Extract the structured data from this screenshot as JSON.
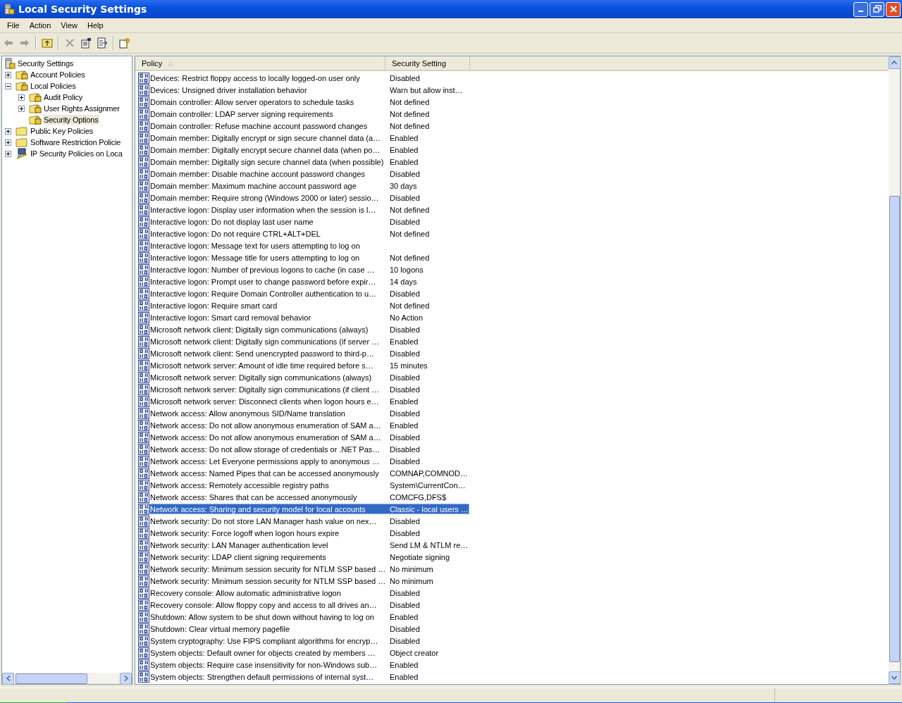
{
  "window": {
    "title": "Local Security Settings"
  },
  "menu": [
    "File",
    "Action",
    "View",
    "Help"
  ],
  "tree": [
    {
      "label": "Security Settings",
      "kind": "root",
      "selected": false,
      "children": [
        {
          "label": "Account Policies",
          "kind": "locked-folder",
          "selected": false,
          "expanded": false
        },
        {
          "label": "Local Policies",
          "kind": "locked-folder",
          "selected": false,
          "expanded": true,
          "children": [
            {
              "label": "Audit Policy",
              "kind": "locked-folder",
              "selected": false,
              "expanded": false
            },
            {
              "label": "User Rights Assignmer",
              "kind": "locked-folder",
              "selected": false,
              "expanded": false
            },
            {
              "label": "Security Options",
              "kind": "locked-folder",
              "selected": true
            }
          ]
        },
        {
          "label": "Public Key Policies",
          "kind": "folder",
          "selected": false,
          "expanded": false
        },
        {
          "label": "Software Restriction Policie",
          "kind": "folder",
          "selected": false,
          "expanded": false
        },
        {
          "label": "IP Security Policies on Loca",
          "kind": "network",
          "selected": false,
          "expanded": false
        }
      ]
    }
  ],
  "table": {
    "columns": [
      "Policy",
      "Security Setting"
    ],
    "rows": [
      {
        "policy": "Devices: Restrict floppy access to locally logged-on user only",
        "setting": "Disabled",
        "selected": false
      },
      {
        "policy": "Devices: Unsigned driver installation behavior",
        "setting": "Warn but allow inst…",
        "selected": false
      },
      {
        "policy": "Domain controller: Allow server operators to schedule tasks",
        "setting": "Not defined",
        "selected": false
      },
      {
        "policy": "Domain controller: LDAP server signing requirements",
        "setting": "Not defined",
        "selected": false
      },
      {
        "policy": "Domain controller: Refuse machine account password changes",
        "setting": "Not defined",
        "selected": false
      },
      {
        "policy": "Domain member: Digitally encrypt or sign secure channel data (a…",
        "setting": "Enabled",
        "selected": false
      },
      {
        "policy": "Domain member: Digitally encrypt secure channel data (when po…",
        "setting": "Enabled",
        "selected": false
      },
      {
        "policy": "Domain member: Digitally sign secure channel data (when possible)",
        "setting": "Enabled",
        "selected": false
      },
      {
        "policy": "Domain member: Disable machine account password changes",
        "setting": "Disabled",
        "selected": false
      },
      {
        "policy": "Domain member: Maximum machine account password age",
        "setting": "30 days",
        "selected": false
      },
      {
        "policy": "Domain member: Require strong (Windows 2000 or later) sessio…",
        "setting": "Disabled",
        "selected": false
      },
      {
        "policy": "Interactive logon: Display user information when the session is l…",
        "setting": "Not defined",
        "selected": false
      },
      {
        "policy": "Interactive logon: Do not display last user name",
        "setting": "Disabled",
        "selected": false
      },
      {
        "policy": "Interactive logon: Do not require CTRL+ALT+DEL",
        "setting": "Not defined",
        "selected": false
      },
      {
        "policy": "Interactive logon: Message text for users attempting to log on",
        "selected": false
      },
      {
        "policy": "Interactive logon: Message title for users attempting to log on",
        "setting": "Not defined",
        "selected": false
      },
      {
        "policy": "Interactive logon: Number of previous logons to cache (in case …",
        "setting": "10 logons",
        "selected": false
      },
      {
        "policy": "Interactive logon: Prompt user to change password before expir…",
        "setting": "14 days",
        "selected": false
      },
      {
        "policy": "Interactive logon: Require Domain Controller authentication to u…",
        "setting": "Disabled",
        "selected": false
      },
      {
        "policy": "Interactive logon: Require smart card",
        "setting": "Not defined",
        "selected": false
      },
      {
        "policy": "Interactive logon: Smart card removal behavior",
        "setting": "No Action",
        "selected": false
      },
      {
        "policy": "Microsoft network client: Digitally sign communications (always)",
        "setting": "Disabled",
        "selected": false
      },
      {
        "policy": "Microsoft network client: Digitally sign communications (if server …",
        "setting": "Enabled",
        "selected": false
      },
      {
        "policy": "Microsoft network client: Send unencrypted password to third-p…",
        "setting": "Disabled",
        "selected": false
      },
      {
        "policy": "Microsoft network server: Amount of idle time required before s…",
        "setting": "15 minutes",
        "selected": false
      },
      {
        "policy": "Microsoft network server: Digitally sign communications (always)",
        "setting": "Disabled",
        "selected": false
      },
      {
        "policy": "Microsoft network server: Digitally sign communications (if client …",
        "setting": "Disabled",
        "selected": false
      },
      {
        "policy": "Microsoft network server: Disconnect clients when logon hours e…",
        "setting": "Enabled",
        "selected": false
      },
      {
        "policy": "Network access: Allow anonymous SID/Name translation",
        "setting": "Disabled",
        "selected": false
      },
      {
        "policy": "Network access: Do not allow anonymous enumeration of SAM a…",
        "setting": "Enabled",
        "selected": false
      },
      {
        "policy": "Network access: Do not allow anonymous enumeration of SAM a…",
        "setting": "Disabled",
        "selected": false
      },
      {
        "policy": "Network access: Do not allow storage of credentials or .NET Pas…",
        "setting": "Disabled",
        "selected": false
      },
      {
        "policy": "Network access: Let Everyone permissions apply to anonymous …",
        "setting": "Disabled",
        "selected": false
      },
      {
        "policy": "Network access: Named Pipes that can be accessed anonymously",
        "setting": "COMNAP,COMNOD…",
        "selected": false
      },
      {
        "policy": "Network access: Remotely accessible registry paths",
        "setting": "System\\CurrentCon…",
        "selected": false
      },
      {
        "policy": "Network access: Shares that can be accessed anonymously",
        "setting": "COMCFG,DFS$",
        "selected": false
      },
      {
        "policy": "Network access: Sharing and security model for local accounts",
        "setting": "Classic - local users …",
        "selected": true
      },
      {
        "policy": "Network security: Do not store LAN Manager hash value on nex…",
        "setting": "Disabled",
        "selected": false
      },
      {
        "policy": "Network security: Force logoff when logon hours expire",
        "setting": "Disabled",
        "selected": false
      },
      {
        "policy": "Network security: LAN Manager authentication level",
        "setting": "Send LM & NTLM re…",
        "selected": false
      },
      {
        "policy": "Network security: LDAP client signing requirements",
        "setting": "Negotiate signing",
        "selected": false
      },
      {
        "policy": "Network security: Minimum session security for NTLM SSP based …",
        "setting": "No minimum",
        "selected": false
      },
      {
        "policy": "Network security: Minimum session security for NTLM SSP based …",
        "setting": "No minimum",
        "selected": false
      },
      {
        "policy": "Recovery console: Allow automatic administrative logon",
        "setting": "Disabled",
        "selected": false
      },
      {
        "policy": "Recovery console: Allow floppy copy and access to all drives an…",
        "setting": "Disabled",
        "selected": false
      },
      {
        "policy": "Shutdown: Allow system to be shut down without having to log on",
        "setting": "Enabled",
        "selected": false
      },
      {
        "policy": "Shutdown: Clear virtual memory pagefile",
        "setting": "Disabled",
        "selected": false
      },
      {
        "policy": "System cryptography: Use FIPS compliant algorithms for encryp…",
        "setting": "Disabled",
        "selected": false
      },
      {
        "policy": "System objects: Default owner for objects created by members …",
        "setting": "Object creator",
        "selected": false
      },
      {
        "policy": "System objects: Require case insensitivity for non-Windows sub…",
        "setting": "Enabled",
        "selected": false
      },
      {
        "policy": "System objects: Strengthen default permissions of internal syst…",
        "setting": "Enabled",
        "selected": false
      }
    ]
  }
}
